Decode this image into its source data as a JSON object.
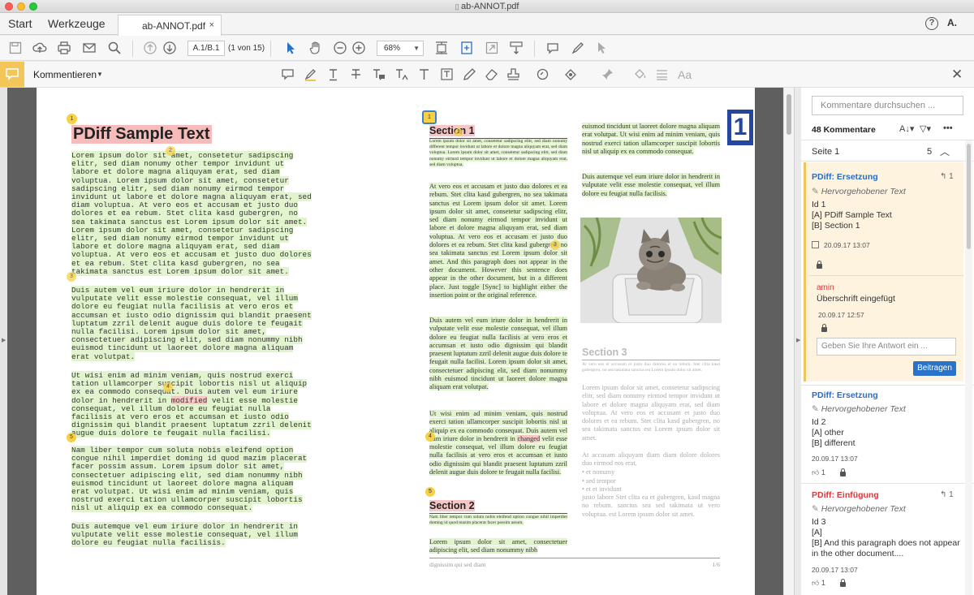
{
  "window": {
    "title": "ab-ANNOT.pdf"
  },
  "tabs": {
    "start": "Start",
    "tools": "Werkzeuge",
    "doc": "ab-ANNOT.pdf",
    "doc_close": "×"
  },
  "header": {
    "help": "?",
    "user": "A."
  },
  "toolbar": {
    "page_value": "A.1/B.1",
    "page_of": "(1 von 15)",
    "zoom": "68%"
  },
  "comment_toolbar": {
    "label": "Kommentieren"
  },
  "document": {
    "left": {
      "marker1": "1",
      "title": "PDiff Sample Text",
      "para1": "Lorem ipsum dolor sit amet, consetetur sadipscing\nelitr, sed diam nonumy other tempor invidunt ut\nlabore et dolore magna aliquyam erat, sed diam\nvoluptua. Lorem ipsum dolor sit amet, consetetur\nsadipscing elitr, sed diam nonumy eirmod tempor\ninvidunt ut labore et dolore magna aliquyam erat, sed\ndiam voluptua. At vero eos et accusam et justo duo\ndolores et ea rebum. Stet clita kasd gubergren, no\nsea takimata sanctus est Lorem ipsum dolor sit amet.\nLorem ipsum dolor sit amet, consetetur sadipscing\nelitr, sed diam nonumy eirmod tempor invidunt ut\nlabore et dolore magna aliquyam erat, sed diam\nvoluptua. At vero eos et accusam et justo duo dolores\net ea rebum. Stet clita kasd gubergren, no sea\ntakimata sanctus est Lorem ipsum dolor sit amet.",
      "para2": "Duis autem vel eum iriure dolor in hendrerit in\nvulputate velit esse molestie consequat, vel illum\ndolore eu feugiat nulla facilisis at vero eros et\naccumsan et iusto odio dignissim qui blandit praesent\nluptatum zzril delenit augue duis dolore te feugait\nnulla facilisi. Lorem ipsum dolor sit amet,\nconsectetuer adipiscing elit, sed diam nonummy nibh\neuismod tincidunt ut laoreet dolore magna aliquam\nerat volutpat.",
      "para3a": "Ut wisi enim ad minim veniam, quis nostrud exerci\ntation ullamcorper suscipit lobortis nisl ut aliquip\nex ea commodo consequat. Duis autem vel eum iriure\ndolor in hendrerit in ",
      "para3_modified": "modified",
      "para3b": " velit esse molestie\nconsequat, vel illum dolore eu feugiat nulla\nfacilisis at vero eros et accumsan et iusto odio\ndignissim qui blandit praesent luptatum zzril delenit\naugue duis dolore te feugait nulla facilisi.",
      "para4": "Nam liber tempor cum soluta nobis eleifend option\ncongue nihil imperdiet doming id quod mazim placerat\nfacer possim assum. Lorem ipsum dolor sit amet,\nconsectetuer adipiscing elit, sed diam nonummy nibh\neuismod tincidunt ut laoreet dolore magna aliquam\nerat volutpat. Ut wisi enim ad minim veniam, quis\nnostrud exerci tation ullamcorper suscipit lobortis\nnisl ut aliquip ex ea commodo consequat.",
      "para5": "Duis autemque vel eum iriure dolor in hendrerit in\nvulputate velit esse molestie consequat, vel illum\ndolore eu feugiat nulla facilisis.",
      "m2": "2",
      "m3": "3",
      "m4": "4",
      "m5": "5"
    },
    "right": {
      "marker1": "1",
      "section1": "Section 1",
      "s1_small": "Lorem ipsum dolor sit amet, consetetur sadipscing elitr, sed diam nonumy different tempor invidunt ut labore et dolore magna aliquyam erat, sed diam voluptua. Lorem ipsum dolor sit amet, consetetur sadipscing elitr, sed diam nonumy eirmod tempor invidunt ut labore et dolore magna aliquyam erat, sed diam voluptua.",
      "s1_p1": "At vero eos et accusam et justo duo dolores et ea rebum. Stet clita kasd gubergren, no sea takimata sanctus est Lorem ipsum dolor sit amet. Lorem ipsum dolor sit amet, consetetur sadipscing elitr, sed diam nonumy eirmod tempor invidunt ut labore et dolore magna aliquyam erat, sed diam voluptua. At vero eos et accusam et justo duo dolores et ea rebum. Stet clita kasd gubergren, no sea takimata sanctus est Lorem ipsum dolor sit amet. And this paragraph does not appear in the other document. However this sentence does appear in the other document, but in a different place. Just toggle [Sync] to highlight either the insertion point or the original reference.",
      "s1_p2": "Duis autem vel eum iriure dolor in hendrerit in vulputate velit esse molestie consequat, vel illum dolore eu feugiat nulla facilisis at vero eros et accumsan et iusto odio dignissim qui blandit praesent luptatum zzril delenit augue duis dolore te feugait nulla facilisi. Lorem ipsum dolor sit amet, consectetuer adipiscing elit, sed diam nonummy nibh euismod tincidunt ut laoreet dolore magna aliquam erat volutpat.",
      "s1_p3a": "Ut wisi enim ad minim veniam, quis nostrud exerci tation ullamcorper suscipit lobortis nisl ut aliquip ex ea commodo consequat. Duis autem vel eum iriure dolor in hendrerit in ",
      "s1_changed": "changed",
      "s1_p3b": " velit esse molestie consequat, vel illum dolore eu feugiat nulla facilisis at vero eros et accumsan et iusto odio dignissim qui blandit praesent luptatum zzril delenit augue duis dolore te feugait nulla facilisi.",
      "section2": "Section 2",
      "s2_small": "Nam liber tempor cum soluta nobis eleifend option congue nihil imperdiet doming id quod mazim placerat facer possim assum.",
      "s2_p1": "Lorem ipsum dolor sit amet, consectetuer adipiscing elit, sed diam nonummy nibh",
      "col2_p1": "euismod tincidunt ut laoreet dolore magna aliquam erat volutpat. Ut wisi enim ad minim veniam, quis nostrud exerci tation ullamcorper suscipit lobortis nisl ut aliquip ex ea commodo consequat.",
      "col2_p2": "Duis autemque vel eum iriure dolor in hendrerit in vulputate velit esse molestie consequat, vel illum dolore eu feugiat nulla facilisis.",
      "section3": "Section 3",
      "s3_small": "At vero eos et accusam et justo duo dolores et ea rebum. Stet clita kasd gubergren, no sea takimata sanctus est Lorem ipsum dolor sit amet.",
      "s3_p1": "Lorem ipsum dolor sit amet, consetetur sadipscing elitr, sed diam nonumy eirmod tempor invidunt ut labore et dolore magna aliquyam erat, sed diam voluptua. At vero eos et accusam et justo duo dolores et ea rebum. Stet clita kasd gubergren, no sea takimata sanctus est Lorem ipsum dolor sit amet.",
      "s3_p2": "At accusam aliquyam diam diam dolore dolores duo eirmod eos erat,",
      "s3_b1": "• et nonumy",
      "s3_b2": "• sed tempor",
      "s3_b3": "• et et invidunt",
      "s3_p3": "justo labore Stet clita ea et gubergren, kasd magna no rebum. sanctus sea sed takimata ut vero voluptua. est Lorem ipsum dolor sit amet.",
      "footer_left": "dignissim qui sed diam",
      "footer_right": "1/6",
      "page_badge": "1",
      "m1b": "1",
      "m2": "2",
      "m3": "3",
      "m4": "4",
      "m5": "5"
    }
  },
  "comments_panel": {
    "search_placeholder": "Kommentare durchsuchen ...",
    "count": "48 Kommentare",
    "page_group": "Seite 1",
    "page_group_count": "5",
    "c1": {
      "title": "PDiff: Ersetzung",
      "replies": "1",
      "type": "Hervorgehobener Text",
      "text": "Id 1\n[A] PDiff Sample Text\n[B] Section 1",
      "date": "20.09.17  13:07",
      "reply_author": "amin",
      "reply_text": "Überschrift eingefügt",
      "reply_date": "20.09.17  12:57",
      "reply_placeholder": "Geben Sie Ihre Antwort ein ...",
      "submit": "Beitragen"
    },
    "c2": {
      "title": "PDiff: Ersetzung",
      "type": "Hervorgehobener Text",
      "text": "Id 2\n[A] other\n[B] different",
      "date": "20.09.17  13:07",
      "likes": "1"
    },
    "c3": {
      "title": "PDiff: Einfügung",
      "replies": "1",
      "type": "Hervorgehobener Text",
      "text": "Id 3\n[A]\n[B] And this paragraph does not appear in the other document....",
      "date": "20.09.17  13:07",
      "likes": "1"
    }
  }
}
